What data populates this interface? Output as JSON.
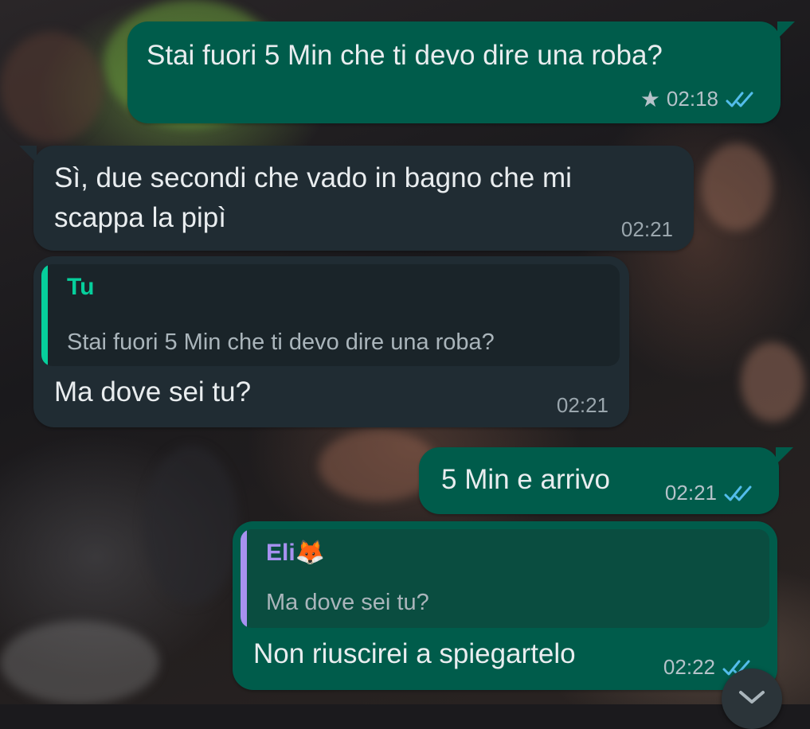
{
  "colors": {
    "outgoing_bubble": "#005c4b",
    "incoming_bubble": "#202c33",
    "read_ticks": "#53bdeb",
    "quote_you": "#06cf9c",
    "quote_eli": "#a791f0"
  },
  "messages": [
    {
      "direction": "outgoing",
      "text": "Stai fuori 5 Min che ti devo dire una roba?",
      "time": "02:18",
      "starred": true,
      "status": "read"
    },
    {
      "direction": "incoming",
      "lines": [
        "Sì, due secondi che vado in bagno che mi",
        "scappa la pipì"
      ],
      "time": "02:21"
    },
    {
      "direction": "incoming",
      "reply_to": {
        "author": "Tu",
        "text": "Stai fuori 5 Min che ti devo dire una roba?"
      },
      "text": "Ma dove sei tu?",
      "time": "02:21"
    },
    {
      "direction": "outgoing",
      "text": "5 Min e arrivo",
      "time": "02:21",
      "status": "read"
    },
    {
      "direction": "outgoing",
      "reply_to": {
        "author": "Eli🦊",
        "text": "Ma dove sei tu?"
      },
      "text": "Non riuscirei a spiegartelo",
      "time": "02:22",
      "status": "read"
    }
  ],
  "icons": {
    "star": "star-icon",
    "read_receipt": "double-check-icon",
    "scroll_down": "chevron-down-icon"
  }
}
